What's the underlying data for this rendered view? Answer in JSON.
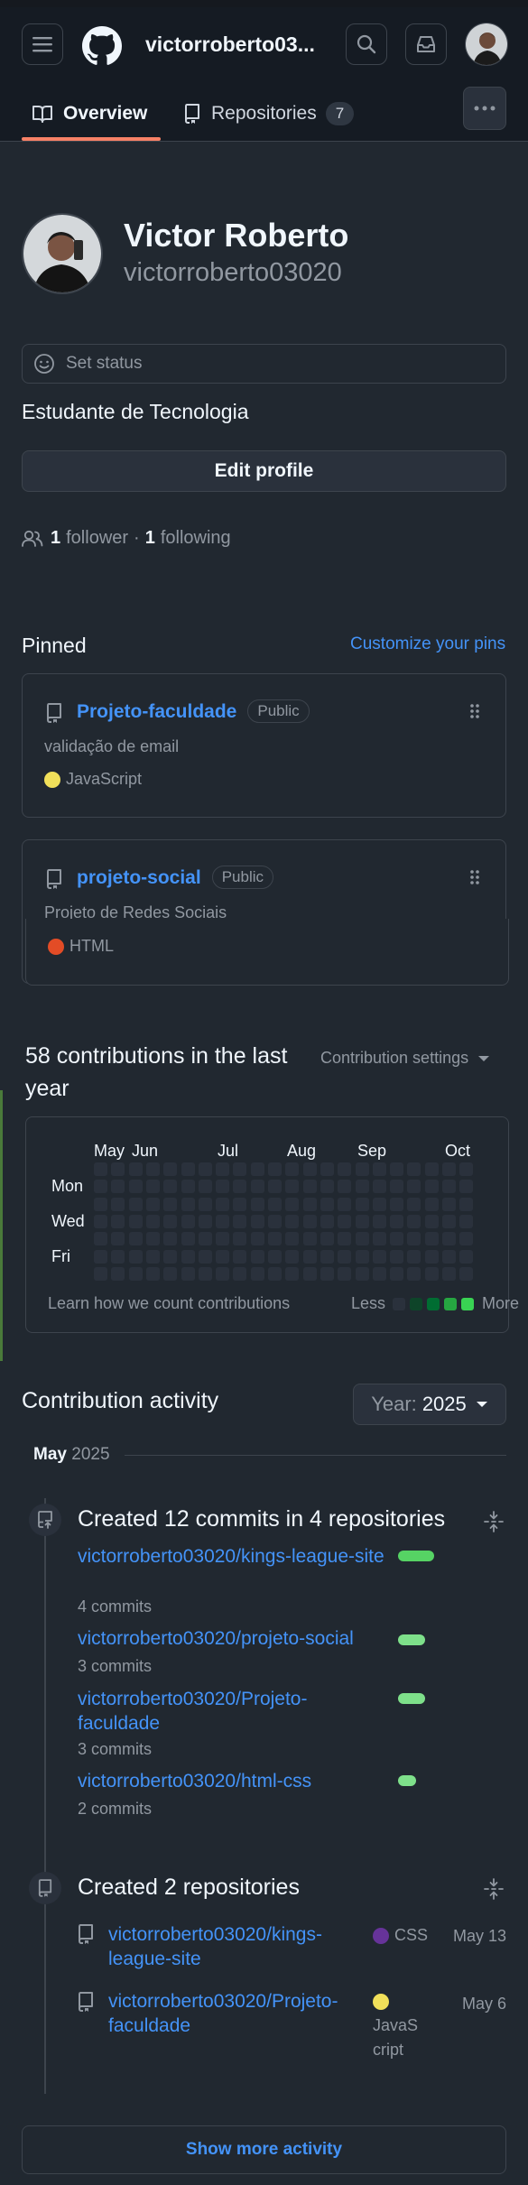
{
  "header": {
    "username": "victorroberto03...",
    "icons": [
      "hamburger-icon",
      "github-logo",
      "search-icon",
      "inbox-icon"
    ]
  },
  "tabs": [
    {
      "label": "Overview",
      "icon": "book-icon",
      "active": true
    },
    {
      "label": "Repositories",
      "icon": "repo-icon",
      "count": "7"
    }
  ],
  "profile": {
    "name": "Victor Roberto",
    "login": "victorroberto03020",
    "status_placeholder": "Set status",
    "bio": "Estudante de Tecnologia",
    "edit_label": "Edit profile",
    "followers_count": "1",
    "followers_label": "follower",
    "separator": "·",
    "following_count": "1",
    "following_label": "following"
  },
  "pinned": {
    "heading": "Pinned",
    "customize": "Customize your pins",
    "items": [
      {
        "name": "Projeto-faculdade",
        "visibility": "Public",
        "description": "validação de email",
        "language": "JavaScript",
        "language_color": "#f1e05a"
      },
      {
        "name": "projeto-social",
        "visibility": "Public",
        "description": "Projeto de Redes Sociais",
        "language": "HTML",
        "language_color": "#e34c26"
      }
    ]
  },
  "contributions": {
    "heading": "58 contributions in the last year",
    "settings": "Contribution settings",
    "months": [
      "May",
      "Jun",
      "Jul",
      "Aug",
      "Sep",
      "Oct"
    ],
    "days": [
      "Mon",
      "Wed",
      "Fri"
    ],
    "learn": "Learn how we count contributions",
    "less": "Less",
    "more": "More",
    "legend_colors": [
      "#2a313c",
      "#0e4429",
      "#006d32",
      "#26a641",
      "#39d353"
    ]
  },
  "activity": {
    "heading": "Contribution activity",
    "year_label": "Year:",
    "year": "2025",
    "month": "May",
    "month_year": "2025",
    "commits_title": "Created 12 commits in 4 repositories",
    "commits": [
      {
        "repo": "victorroberto03020/kings-league-site",
        "count": "4 commits",
        "share": 1.0
      },
      {
        "repo": "victorroberto03020/projeto-social",
        "count": "3 commits",
        "share": 0.75
      },
      {
        "repo": "victorroberto03020/Projeto-faculdade",
        "count": "3 commits",
        "share": 0.75
      },
      {
        "repo": "victorroberto03020/html-css",
        "count": "2 commits",
        "share": 0.5
      }
    ],
    "repos_title": "Created 2 repositories",
    "repos": [
      {
        "name": "victorroberto03020/kings-league-site",
        "language": "CSS",
        "language_color": "#663399",
        "date": "May 13"
      },
      {
        "name": "victorroberto03020/Projeto-faculdade",
        "language": "JavaScript",
        "language_color": "#f1e05a",
        "date": "May 6"
      }
    ],
    "show_more": "Show more activity"
  }
}
